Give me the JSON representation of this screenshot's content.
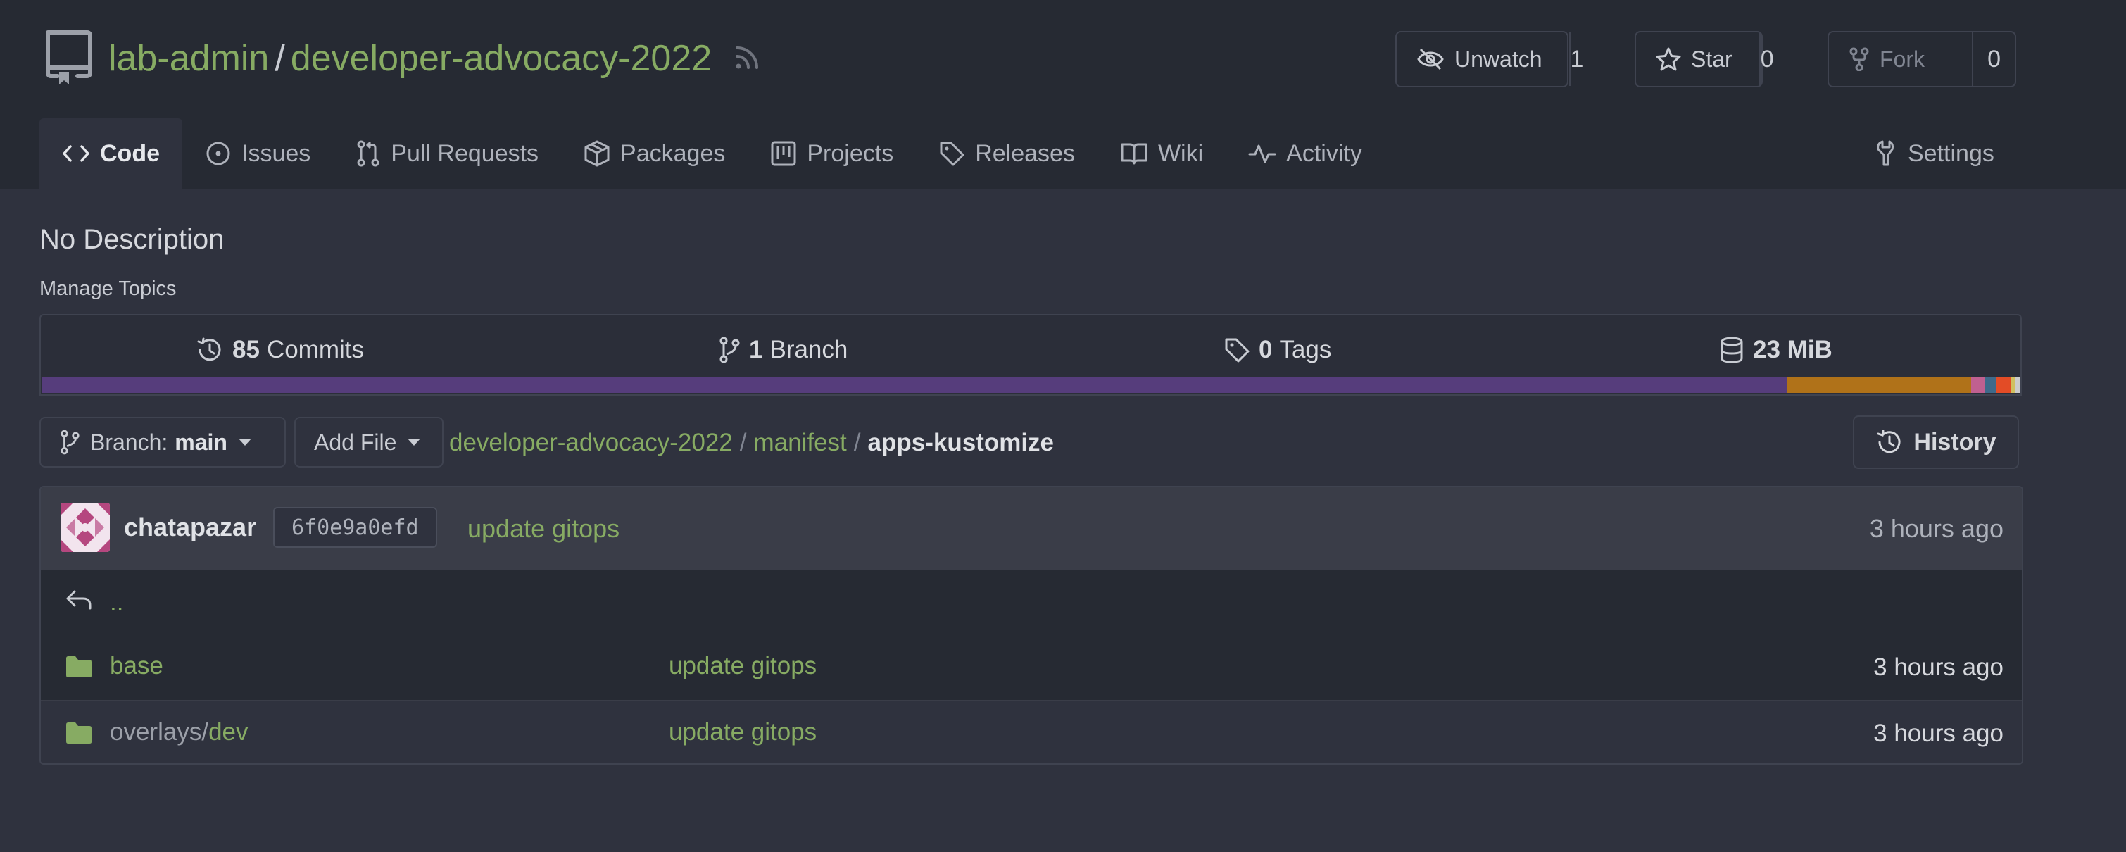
{
  "repo": {
    "owner": "lab-admin",
    "separator": "/",
    "name": "developer-advocacy-2022"
  },
  "actions": {
    "watch": {
      "label": "Unwatch",
      "count": "1"
    },
    "star": {
      "label": "Star",
      "count": "0"
    },
    "fork": {
      "label": "Fork",
      "count": "0"
    }
  },
  "tabs": [
    {
      "label": "Code",
      "icon": "code-icon",
      "active": true
    },
    {
      "label": "Issues",
      "icon": "issue-icon"
    },
    {
      "label": "Pull Requests",
      "icon": "pull-request-icon"
    },
    {
      "label": "Packages",
      "icon": "package-icon"
    },
    {
      "label": "Projects",
      "icon": "project-icon"
    },
    {
      "label": "Releases",
      "icon": "tag-icon"
    },
    {
      "label": "Wiki",
      "icon": "book-icon"
    },
    {
      "label": "Activity",
      "icon": "pulse-icon"
    },
    {
      "label": "Settings",
      "icon": "tools-icon"
    }
  ],
  "description": "No Description",
  "manage_topics": "Manage Topics",
  "stats": {
    "commits": {
      "count": "85",
      "label": "Commits"
    },
    "branches": {
      "count": "1",
      "label": "Branch"
    },
    "tags": {
      "count": "0",
      "label": "Tags"
    },
    "size": {
      "value": "23 MiB"
    }
  },
  "language_bar": [
    {
      "color": "#563d7c",
      "fraction": 0.882
    },
    {
      "color": "#b07219",
      "fraction": 0.093
    },
    {
      "color": "#c06090",
      "fraction": 0.007
    },
    {
      "color": "#3e6a8a",
      "fraction": 0.006
    },
    {
      "color": "#e34c26",
      "fraction": 0.007
    },
    {
      "color": "#d0c060",
      "fraction": 0.002
    },
    {
      "color": "#cccccc",
      "fraction": 0.003
    }
  ],
  "toolbar": {
    "branch_prefix": "Branch:",
    "branch_name": "main",
    "add_file": "Add File",
    "history": "History"
  },
  "breadcrumb": {
    "root": "developer-advocacy-2022",
    "sep1": "/",
    "dir": "manifest",
    "sep2": "/",
    "current": "apps-kustomize"
  },
  "latest_commit": {
    "author": "chatapazar",
    "sha": "6f0e9a0efd",
    "message": "update gitops",
    "time": "3 hours ago"
  },
  "parent_link": "..",
  "files": [
    {
      "name": "base",
      "message": "update gitops",
      "time": "3 hours ago"
    },
    {
      "name_prefix": "overlays/",
      "name": "dev",
      "message": "update gitops",
      "time": "3 hours ago"
    }
  ]
}
